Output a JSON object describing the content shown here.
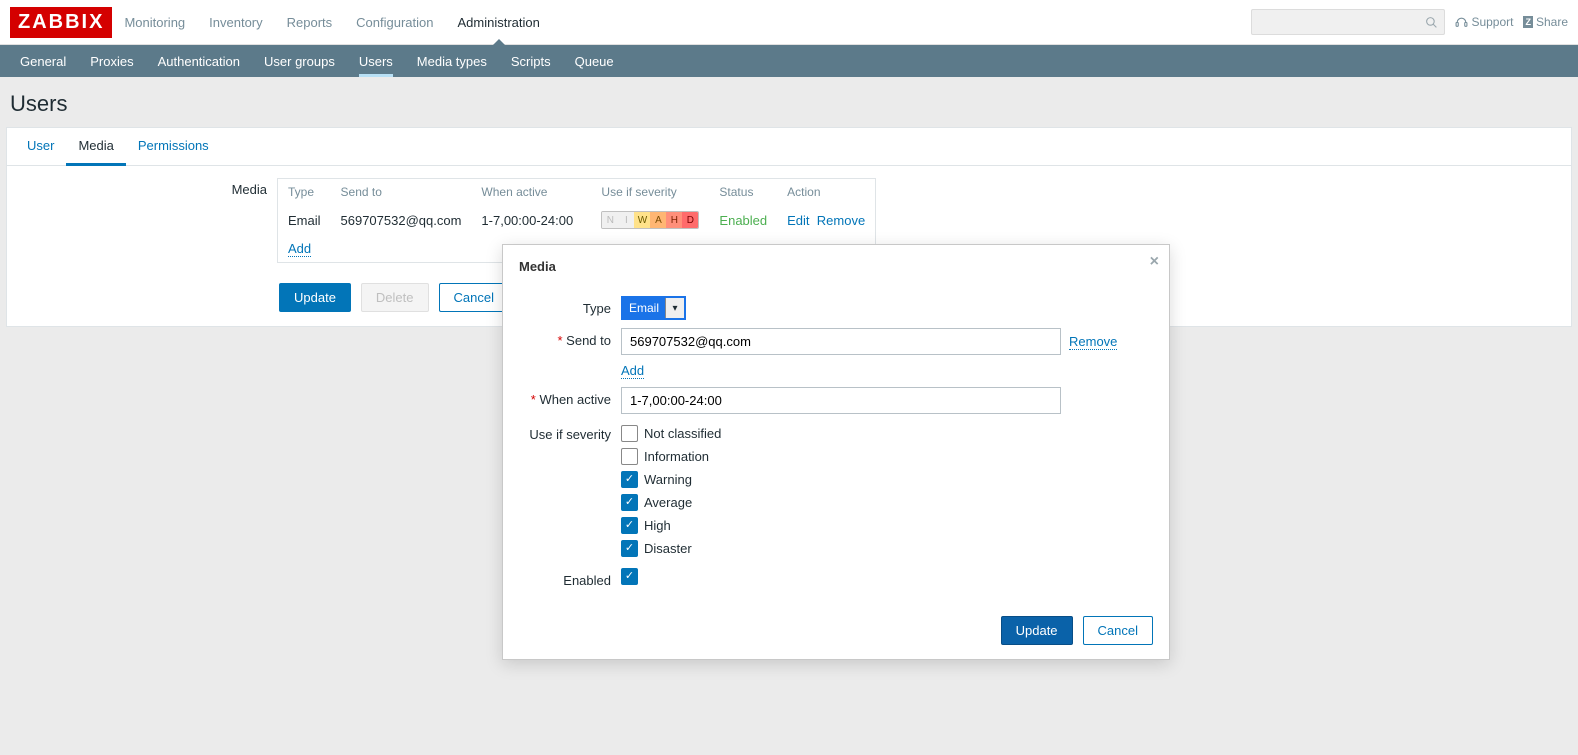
{
  "brand": "ZABBIX",
  "topnav": {
    "items": [
      "Monitoring",
      "Inventory",
      "Reports",
      "Configuration",
      "Administration"
    ],
    "active": 4
  },
  "topright": {
    "support": "Support",
    "share": "Share"
  },
  "subnav": {
    "items": [
      "General",
      "Proxies",
      "Authentication",
      "User groups",
      "Users",
      "Media types",
      "Scripts",
      "Queue"
    ],
    "active": 4
  },
  "page_title": "Users",
  "tabs": {
    "items": [
      "User",
      "Media",
      "Permissions"
    ],
    "active": 1
  },
  "media_section_label": "Media",
  "media_table": {
    "headers": {
      "type": "Type",
      "send_to": "Send to",
      "when_active": "When active",
      "use_if": "Use if severity",
      "status": "Status",
      "action": "Action"
    },
    "row": {
      "type": "Email",
      "send_to": "569707532@qq.com",
      "when_active": "1-7,00:00-24:00",
      "status": "Enabled",
      "edit": "Edit",
      "remove": "Remove"
    },
    "severity_letters": {
      "n": "N",
      "i": "I",
      "w": "W",
      "a": "A",
      "h": "H",
      "d": "D"
    },
    "add": "Add"
  },
  "buttons": {
    "update": "Update",
    "delete": "Delete",
    "cancel": "Cancel"
  },
  "modal": {
    "title": "Media",
    "labels": {
      "type": "Type",
      "send_to": "Send to",
      "when_active": "When active",
      "use_if": "Use if severity",
      "enabled": "Enabled"
    },
    "type_value": "Email",
    "send_to_value": "569707532@qq.com",
    "remove": "Remove",
    "add": "Add",
    "when_active_value": "1-7,00:00-24:00",
    "severities": [
      {
        "label": "Not classified",
        "checked": false
      },
      {
        "label": "Information",
        "checked": false
      },
      {
        "label": "Warning",
        "checked": true
      },
      {
        "label": "Average",
        "checked": true
      },
      {
        "label": "High",
        "checked": true
      },
      {
        "label": "Disaster",
        "checked": true
      }
    ],
    "enabled_checked": true,
    "buttons": {
      "update": "Update",
      "cancel": "Cancel"
    }
  }
}
